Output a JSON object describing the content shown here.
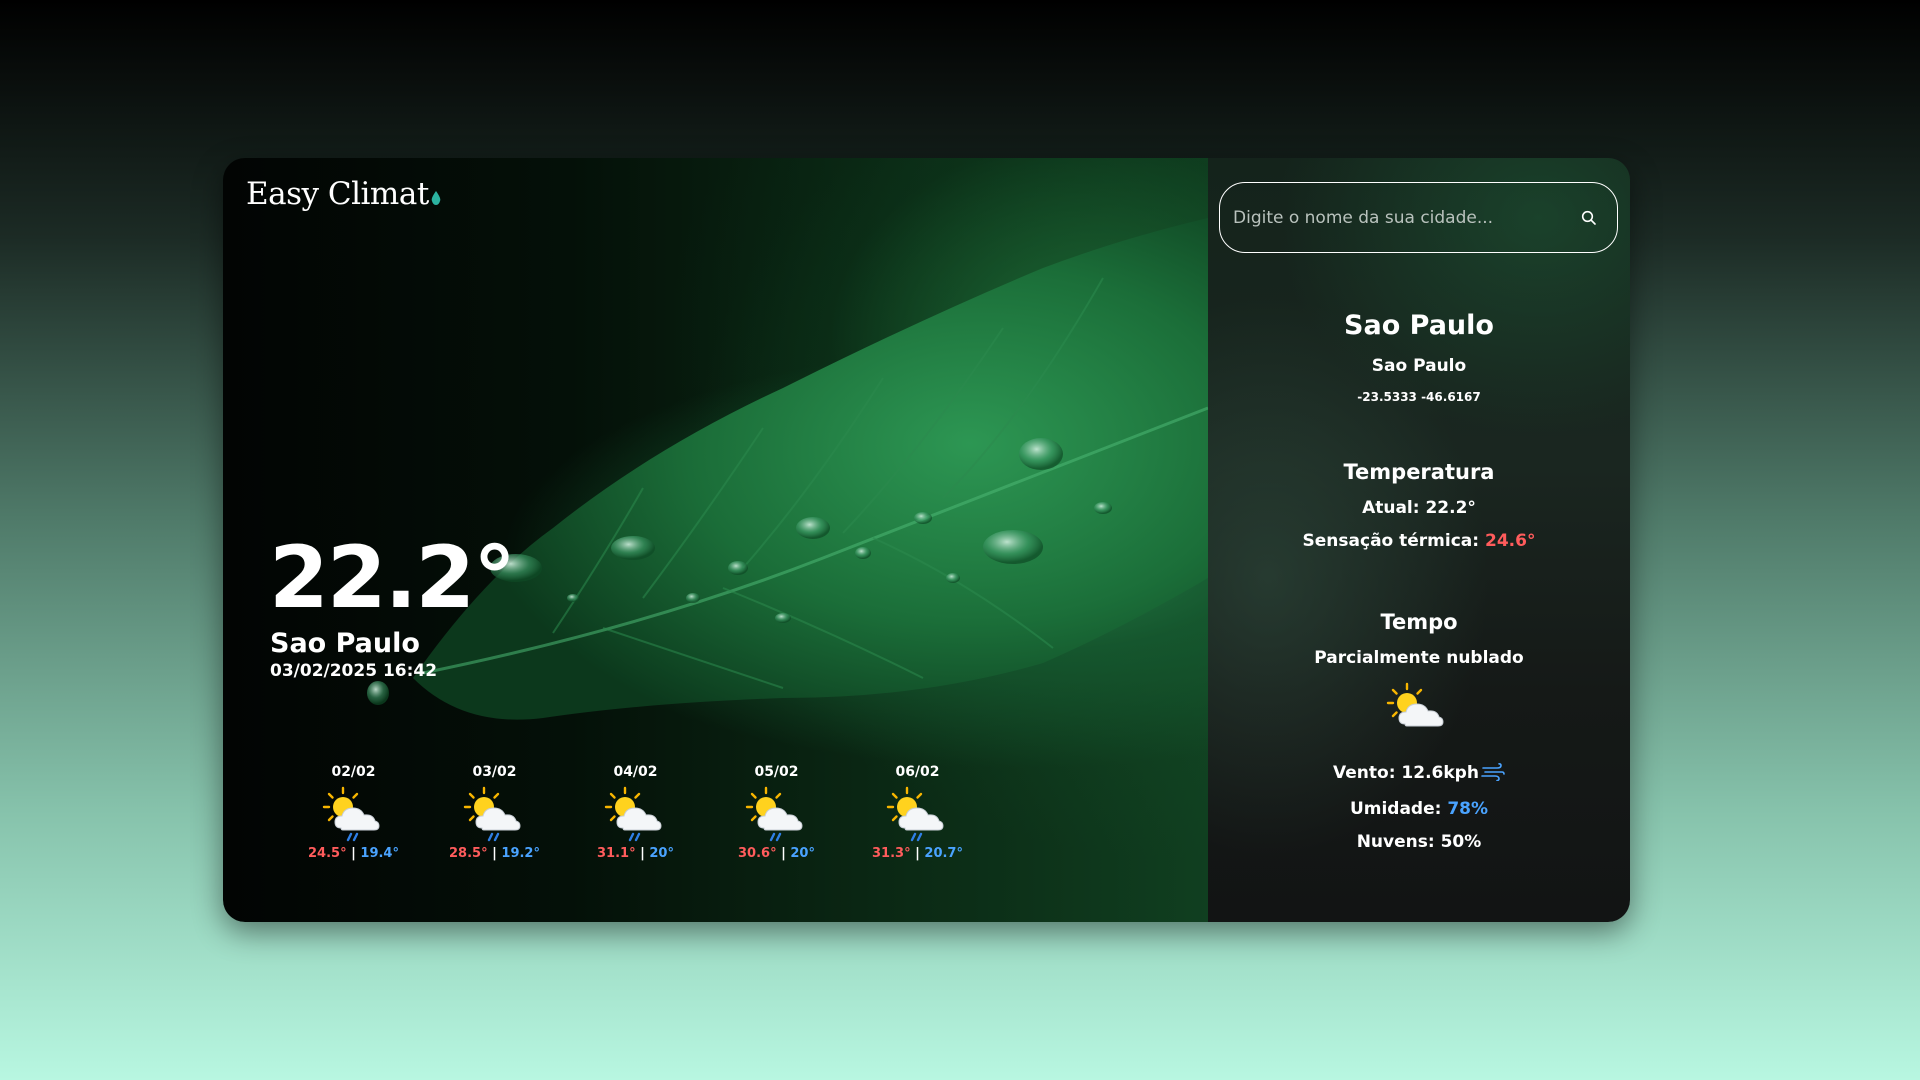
{
  "app": {
    "logo_text": "Easy Climat"
  },
  "current": {
    "temp": "22.2°",
    "city": "Sao Paulo",
    "datetime": "03/02/2025 16:42"
  },
  "forecast": [
    {
      "date": "02/02",
      "max": "24.5°",
      "min": "19.4°",
      "icon": "partly-cloudy-rain-icon"
    },
    {
      "date": "03/02",
      "max": "28.5°",
      "min": "19.2°",
      "icon": "partly-cloudy-rain-icon"
    },
    {
      "date": "04/02",
      "max": "31.1°",
      "min": "20°",
      "icon": "partly-cloudy-rain-icon"
    },
    {
      "date": "05/02",
      "max": "30.6°",
      "min": "20°",
      "icon": "partly-cloudy-rain-icon"
    },
    {
      "date": "06/02",
      "max": "31.3°",
      "min": "20.7°",
      "icon": "partly-cloudy-rain-icon"
    }
  ],
  "separator": "|",
  "search": {
    "placeholder": "Digite o nome da sua cidade...",
    "value": ""
  },
  "details": {
    "city": "Sao Paulo",
    "region": "Sao Paulo",
    "coords": "-23.5333 -46.6167",
    "temp_heading": "Temperatura",
    "atual_label": "Atual:",
    "atual_value": "22.2°",
    "feels_label": "Sensação térmica:",
    "feels_value": "24.6°",
    "weather_heading": "Tempo",
    "condition": "Parcialmente nublado",
    "condition_icon": "partly-cloudy-icon",
    "wind_label": "Vento:",
    "wind_value": "12.6kph",
    "humidity_label": "Umidade:",
    "humidity_value": "78%",
    "clouds_label": "Nuvens:",
    "clouds_value": "50%"
  },
  "colors": {
    "max_temp": "#ff5c5c",
    "min_temp": "#4aa3ff",
    "accent_green": "#1d6b3a"
  }
}
